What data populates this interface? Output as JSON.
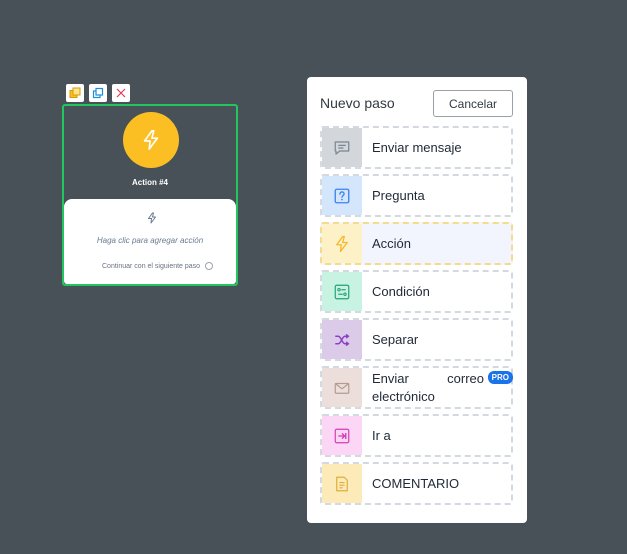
{
  "canvas": {
    "node": {
      "title": "Action #4",
      "hint": "Haga clic para agregar acción",
      "continue_label": "Continuar con el siguiente paso",
      "accent_color": "#fbbf24",
      "selected_border_color": "#22c55e"
    },
    "toolbar": {
      "icons": [
        "copy-icon",
        "duplicate-icon",
        "close-icon"
      ]
    }
  },
  "panel": {
    "title": "Nuevo paso",
    "cancel_label": "Cancelar",
    "steps": [
      {
        "label": "Enviar mensaje",
        "icon": "message-icon",
        "icon_bg": "#d3d7dc",
        "icon_color": "#7a8591"
      },
      {
        "label": "Pregunta",
        "icon": "question-icon",
        "icon_bg": "#d3e6fb",
        "icon_color": "#3b82f6"
      },
      {
        "label": "Acción",
        "icon": "lightning-icon",
        "icon_bg": "#fdf1c8",
        "icon_color": "#f5b82e"
      },
      {
        "label": "Condición",
        "icon": "condition-icon",
        "icon_bg": "#c8f3e2",
        "icon_color": "#22a37a"
      },
      {
        "label": "Separar",
        "icon": "shuffle-icon",
        "icon_bg": "#dccbe8",
        "icon_color": "#8b3fc4"
      },
      {
        "label_line1": "Enviar correo",
        "label_line2": "electrónico",
        "badge": "PRO",
        "icon": "mail-icon",
        "icon_bg": "#ecdfdb",
        "icon_color": "#b59a94"
      },
      {
        "label": "Ir a",
        "icon": "goto-icon",
        "icon_bg": "#fbd7f5",
        "icon_color": "#d63cb8"
      },
      {
        "label": "COMENTARIO",
        "icon": "note-icon",
        "icon_bg": "#fcebb9",
        "icon_color": "#e0ad38"
      }
    ]
  }
}
